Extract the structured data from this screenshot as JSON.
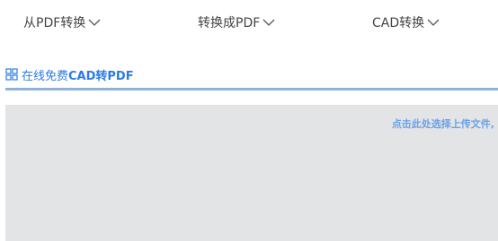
{
  "nav": {
    "items": [
      {
        "label": "从PDF转换"
      },
      {
        "label": "转换成PDF"
      },
      {
        "label": "CAD转换"
      }
    ]
  },
  "section": {
    "title_prefix": "在线免费",
    "title_bold": "CAD转PDF",
    "accent_color": "#2b7be4",
    "icon": "grid-icon"
  },
  "dropzone": {
    "hint": "点击此处选择上传文件,"
  }
}
